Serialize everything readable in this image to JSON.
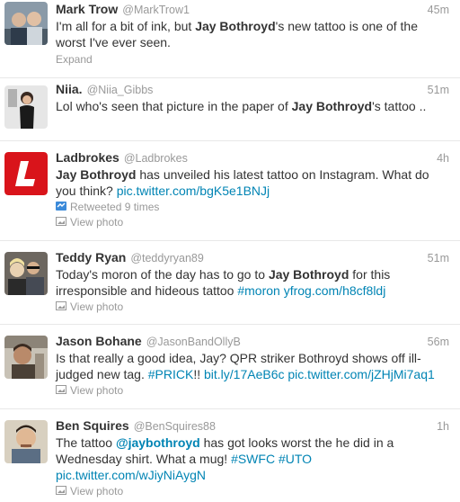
{
  "tweets": [
    {
      "fullname": "Mark Trow",
      "username": "@MarkTrow1",
      "time": "45m",
      "text": [
        {
          "t": "I'm all for a bit of ink, but "
        },
        {
          "t": "Jay Bothroyd",
          "s": "bold"
        },
        {
          "t": "'s new tattoo is one of the worst I've ever seen."
        }
      ],
      "footer": "Expand",
      "footer_icon": ""
    },
    {
      "fullname": "Niia.",
      "username": "@Niia_Gibbs",
      "time": "51m",
      "text": [
        {
          "t": "Lol who's seen that picture in the paper of "
        },
        {
          "t": "Jay Bothroyd",
          "s": "bold"
        },
        {
          "t": "'s tattoo .."
        }
      ],
      "footer": "",
      "footer_icon": ""
    },
    {
      "fullname": "Ladbrokes",
      "username": "@Ladbrokes",
      "time": "4h",
      "text": [
        {
          "t": "Jay Bothroyd",
          "s": "bold"
        },
        {
          "t": " has unveiled his latest tattoo on Instagram. What do you think? "
        },
        {
          "t": "pic.twitter.com/bgK5e1BNJj",
          "s": "link"
        }
      ],
      "retweeted": "Retweeted 9 times",
      "footer": "View photo",
      "footer_icon": "photo-icon"
    },
    {
      "fullname": "Teddy Ryan",
      "username": "@teddyryan89",
      "time": "51m",
      "text": [
        {
          "t": "Today's moron of the day has to go to "
        },
        {
          "t": "Jay Bothroyd",
          "s": "bold"
        },
        {
          "t": " for this irresponsible and hideous tattoo "
        },
        {
          "t": "#moron",
          "s": "hashtag"
        },
        {
          "t": " "
        },
        {
          "t": "yfrog.com/h8cf8ldj",
          "s": "link"
        }
      ],
      "footer": "View photo",
      "footer_icon": "photo-icon"
    },
    {
      "fullname": "Jason Bohane",
      "username": "@JasonBandOllyB",
      "time": "56m",
      "text": [
        {
          "t": "Is that really a good idea, Jay? QPR striker Bothroyd shows off ill-judged new tag. "
        },
        {
          "t": "#PRICK",
          "s": "hashtag"
        },
        {
          "t": "!! "
        },
        {
          "t": "bit.ly/17AeB6c",
          "s": "link"
        },
        {
          "t": " "
        },
        {
          "t": "pic.twitter.com/jZHjMi7aq1",
          "s": "link"
        }
      ],
      "footer": "View photo",
      "footer_icon": "photo-icon"
    },
    {
      "fullname": "Ben Squires",
      "username": "@BenSquires88",
      "time": "1h",
      "text": [
        {
          "t": "The tattoo "
        },
        {
          "t": "@jaybothroyd",
          "s": "mention"
        },
        {
          "t": " has got looks worst the he did in a Wednesday shirt. What a mug! "
        },
        {
          "t": "#SWFC",
          "s": "hashtag"
        },
        {
          "t": " "
        },
        {
          "t": "#UTO",
          "s": "hashtag"
        },
        {
          "t": " "
        },
        {
          "t": "pic.twitter.com/wJiyNiAygN",
          "s": "link"
        }
      ],
      "footer": "View photo",
      "footer_icon": "photo-icon"
    }
  ],
  "colors": {
    "link": "#0084b4",
    "muted": "#999999",
    "text": "#333333",
    "ladbrokes_red": "#d9141b"
  }
}
